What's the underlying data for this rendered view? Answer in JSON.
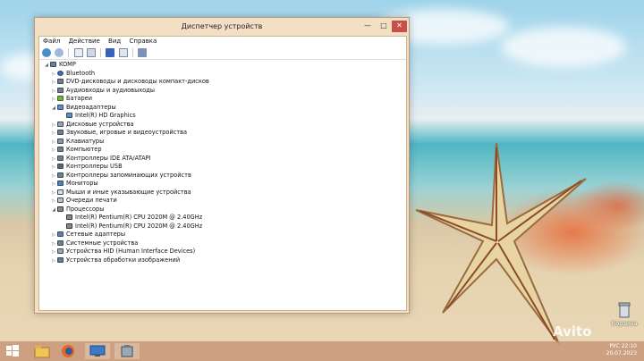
{
  "window": {
    "title": "Диспетчер устройств",
    "controls": {
      "minimize": "—",
      "maximize": "□",
      "close": "✕"
    }
  },
  "menu": [
    "Файл",
    "Действие",
    "Вид",
    "Справка"
  ],
  "toolbar": [
    "back-arrow-icon",
    "forward-arrow-icon",
    "properties-icon",
    "list-icon",
    "help-icon",
    "list-view-icon",
    "scan-hardware-icon"
  ],
  "tree": {
    "root": "KOMP",
    "items": [
      {
        "label": "Bluetooth",
        "expanded": false
      },
      {
        "label": "DVD-дисководы и дисководы компакт-дисков",
        "expanded": false
      },
      {
        "label": "Аудиовходы и аудиовыходы",
        "expanded": false
      },
      {
        "label": "Батареи",
        "expanded": false
      },
      {
        "label": "Видеоадаптеры",
        "expanded": true,
        "children": [
          "Intel(R) HD Graphics"
        ]
      },
      {
        "label": "Дисковые устройства",
        "expanded": false
      },
      {
        "label": "Звуковые, игровые и видеоустройства",
        "expanded": false
      },
      {
        "label": "Клавиатуры",
        "expanded": false
      },
      {
        "label": "Компьютер",
        "expanded": false
      },
      {
        "label": "Контроллеры IDE ATA/ATAPI",
        "expanded": false
      },
      {
        "label": "Контроллеры USB",
        "expanded": false
      },
      {
        "label": "Контроллеры запоминающих устройств",
        "expanded": false
      },
      {
        "label": "Мониторы",
        "expanded": false
      },
      {
        "label": "Мыши и иные указывающие устройства",
        "expanded": false
      },
      {
        "label": "Очереди печати",
        "expanded": false
      },
      {
        "label": "Процессоры",
        "expanded": true,
        "children": [
          "Intel(R) Pentium(R) CPU 2020M @ 2.40GHz",
          "Intel(R) Pentium(R) CPU 2020M @ 2.40GHz"
        ]
      },
      {
        "label": "Сетевые адаптеры",
        "expanded": false
      },
      {
        "label": "Системные устройства",
        "expanded": false
      },
      {
        "label": "Устройства HID (Human Interface Devices)",
        "expanded": false
      },
      {
        "label": "Устройства обработки изображений",
        "expanded": false
      }
    ]
  },
  "desktop": {
    "recycle_bin": "Корзина",
    "watermark": "Avito"
  },
  "taskbar": {
    "icons": [
      "windows-start-icon",
      "file-explorer-icon",
      "firefox-icon",
      "remote-desktop-icon",
      "device-manager-icon"
    ],
    "lang": "РУС",
    "time": "22:10",
    "date": "20.07.2023"
  }
}
